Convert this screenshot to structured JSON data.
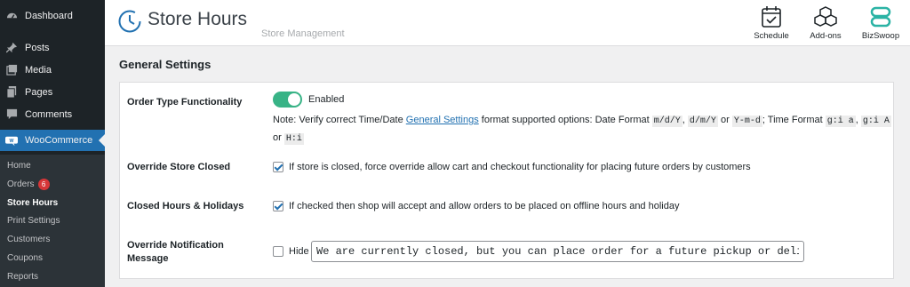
{
  "sidebar": {
    "items": [
      {
        "label": "Dashboard",
        "icon": "dashboard-icon"
      },
      {
        "label": "Posts",
        "icon": "pin-icon"
      },
      {
        "label": "Media",
        "icon": "media-icon"
      },
      {
        "label": "Pages",
        "icon": "pages-icon"
      },
      {
        "label": "Comments",
        "icon": "comment-icon"
      }
    ],
    "active": {
      "label": "WooCommerce",
      "icon": "woo-icon"
    },
    "submenu": [
      {
        "label": "Home"
      },
      {
        "label": "Orders",
        "badge": "6"
      },
      {
        "label": "Store Hours"
      },
      {
        "label": "Print Settings"
      },
      {
        "label": "Customers"
      },
      {
        "label": "Coupons"
      },
      {
        "label": "Reports"
      }
    ]
  },
  "header": {
    "title": "Store Hours",
    "subtitle": "Store Management",
    "buttons": [
      {
        "label": "Schedule",
        "icon": "calendar-check-icon"
      },
      {
        "label": "Add-ons",
        "icon": "boxes-icon"
      },
      {
        "label": "BizSwoop",
        "icon": "bizswoop-icon"
      }
    ]
  },
  "section": {
    "title": "General Settings"
  },
  "settings": {
    "order_type": {
      "label": "Order Type Functionality",
      "toggle_label": "Enabled",
      "note_prefix": "Note: Verify correct Time/Date ",
      "note_link": "General Settings",
      "note_mid": " format supported options: Date Format ",
      "date_formats": [
        "m/d/Y",
        "d/m/Y",
        "Y-m-d"
      ],
      "time_label": "; Time Format ",
      "time_formats": [
        "g:i a",
        "g:i A",
        "H:i"
      ],
      "sep": ", ",
      "or": " or "
    },
    "override_closed": {
      "label": "Override Store Closed",
      "checkbox_label": "If store is closed, force override allow cart and checkout functionality for placing future orders by customers"
    },
    "closed_hours": {
      "label": "Closed Hours & Holidays",
      "checkbox_label": "If checked then shop will accept and allow orders to be placed on offline hours and holiday"
    },
    "notification": {
      "label_line1": "Override Notification",
      "label_line2": "Message",
      "hide_label": "Hide",
      "message_value": "We are currently closed, but you can place order for a future pickup or delivery!"
    }
  },
  "colors": {
    "sidebar_bg": "#1d2327",
    "active_menu": "#2271b1",
    "toggle_on": "#38b386",
    "bizswoop": "#2bb3a5",
    "badge": "#d63638"
  }
}
